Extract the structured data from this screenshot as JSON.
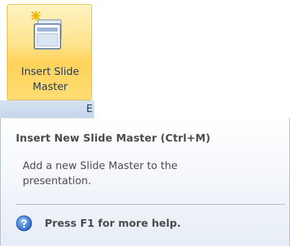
{
  "ribbon": {
    "button": {
      "label_line1": "Insert Slide",
      "label_line2": "Master",
      "icon": "insert-slide-master-icon"
    },
    "group_label": "E"
  },
  "tooltip": {
    "title": "Insert New Slide Master (Ctrl+M)",
    "description_line1": "Add a new Slide Master to the",
    "description_line2": "presentation.",
    "help_text": "Press F1 for more help.",
    "help_icon": "help-icon"
  },
  "colors": {
    "button_highlight": "#ffd35a",
    "button_border": "#e8bc52",
    "text": "#4c4c4c",
    "ribbon_text": "#1e395b",
    "help_icon": "#2f6fc8"
  }
}
